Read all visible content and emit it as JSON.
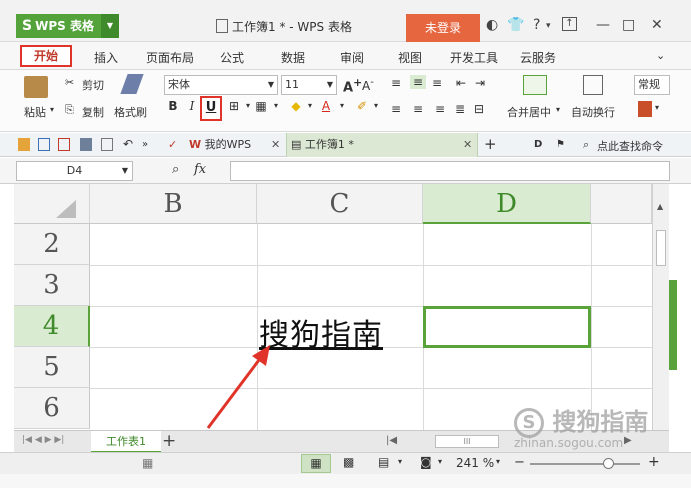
{
  "app": {
    "name": "WPS 表格",
    "doc_title": "工作簿1 * - WPS 表格",
    "login": "未登录",
    "help": "?"
  },
  "menu_tabs": [
    "开始",
    "插入",
    "页面布局",
    "公式",
    "数据",
    "审阅",
    "视图",
    "开发工具",
    "云服务"
  ],
  "ribbon": {
    "paste": "粘贴",
    "cut": "剪切",
    "copy": "复制",
    "format_painter": "格式刷",
    "font_name": "宋体",
    "font_size": "11",
    "bold": "B",
    "italic": "I",
    "underline": "U",
    "merge_center": "合并居中",
    "wrap_text": "自动换行",
    "number_format": "常规"
  },
  "quick_bar": {
    "tab_mywps": "我的WPS",
    "tab_workbook": "工作簿1 *",
    "search": "点此查找命令"
  },
  "formula_bar": {
    "name_box": "D4",
    "fx": "fx",
    "value": ""
  },
  "grid": {
    "columns": [
      "B",
      "C",
      "D"
    ],
    "selected_column": "D",
    "rows": [
      "2",
      "3",
      "4",
      "5",
      "6"
    ],
    "selected_row": "4",
    "cell_text": "搜狗指南"
  },
  "sheets": {
    "active": "工作表1",
    "add": "+"
  },
  "status": {
    "zoom": "241 %"
  },
  "watermark": {
    "brand": "搜狗指南",
    "url": "zhinan.sogou.com"
  },
  "colors": {
    "accent_green": "#5aa33a",
    "highlight_red": "#e0342a",
    "login_orange": "#e5663f"
  }
}
